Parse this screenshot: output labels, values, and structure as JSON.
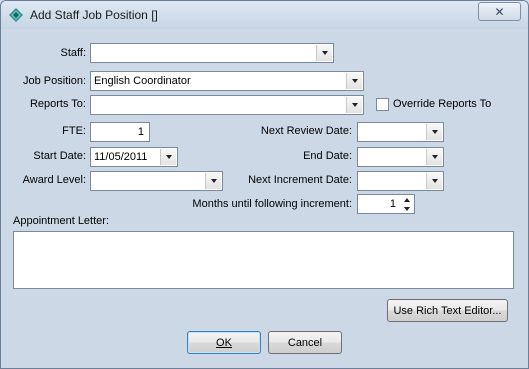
{
  "window": {
    "title": "Add Staff Job Position []",
    "close_symbol": "✕"
  },
  "form": {
    "staff": {
      "label": "Staff:",
      "value": ""
    },
    "job_position": {
      "label": "Job Position:",
      "value": "English Coordinator"
    },
    "reports_to": {
      "label": "Reports To:",
      "value": ""
    },
    "override_reports_to": {
      "label": "Override Reports To",
      "checked": false
    },
    "fte": {
      "label": "FTE:",
      "value": "1"
    },
    "next_review_date": {
      "label": "Next Review Date:",
      "value": ""
    },
    "start_date": {
      "label": "Start Date:",
      "value": "11/05/2011"
    },
    "end_date": {
      "label": "End Date:",
      "value": ""
    },
    "award_level": {
      "label": "Award Level:",
      "value": ""
    },
    "next_increment_date": {
      "label": "Next Increment Date:",
      "value": ""
    },
    "months_until_increment": {
      "label": "Months until following increment:",
      "value": "1"
    },
    "appointment_letter": {
      "label": "Appointment Letter:",
      "value": ""
    }
  },
  "buttons": {
    "rich_text": "Use Rich Text Editor...",
    "ok": "OK",
    "cancel": "Cancel"
  }
}
